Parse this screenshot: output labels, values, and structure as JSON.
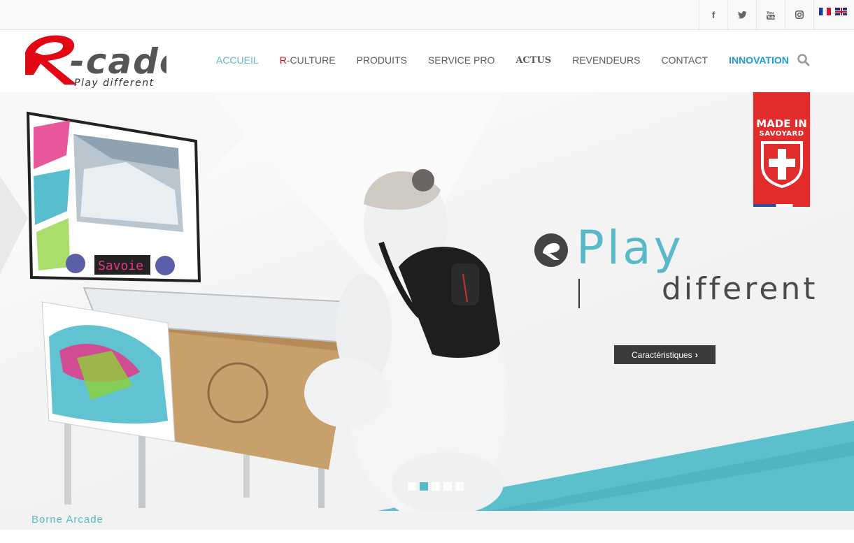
{
  "social": {
    "items": [
      {
        "name": "facebook-icon",
        "glyph": "f"
      },
      {
        "name": "twitter-icon",
        "glyph": "t"
      },
      {
        "name": "youtube-icon",
        "glyph": "▶"
      },
      {
        "name": "instagram-icon",
        "glyph": "◎"
      }
    ],
    "languages": [
      "fr",
      "en"
    ]
  },
  "nav": {
    "items": [
      {
        "label": "ACCUEIL",
        "state": "active"
      },
      {
        "prefix": "R",
        "label": "-CULTURE"
      },
      {
        "label": "PRODUITS"
      },
      {
        "label": "SERVICE PRO"
      },
      {
        "label": "ACTUS"
      },
      {
        "label": "REVENDEURS"
      },
      {
        "label": "CONTACT"
      },
      {
        "label": "INNOVATION",
        "state": "highlight"
      }
    ]
  },
  "logo": {
    "text": "R-cade",
    "tagline": "Play different"
  },
  "hero": {
    "badge_line1": "MADE IN",
    "badge_line2": "SAVOYARD",
    "slogan_play": "Play",
    "slogan_different": "different",
    "cta_label": "Caractéristiques",
    "slides_count": 5,
    "active_slide": 2,
    "pinball_display_text": "Savoie"
  },
  "strip": {
    "label": "Borne Arcade"
  },
  "colors": {
    "accent": "#5ab9c9",
    "innovation": "#1e9bd7",
    "logo_red": "#e30613",
    "badge_red": "#e22c2c"
  }
}
